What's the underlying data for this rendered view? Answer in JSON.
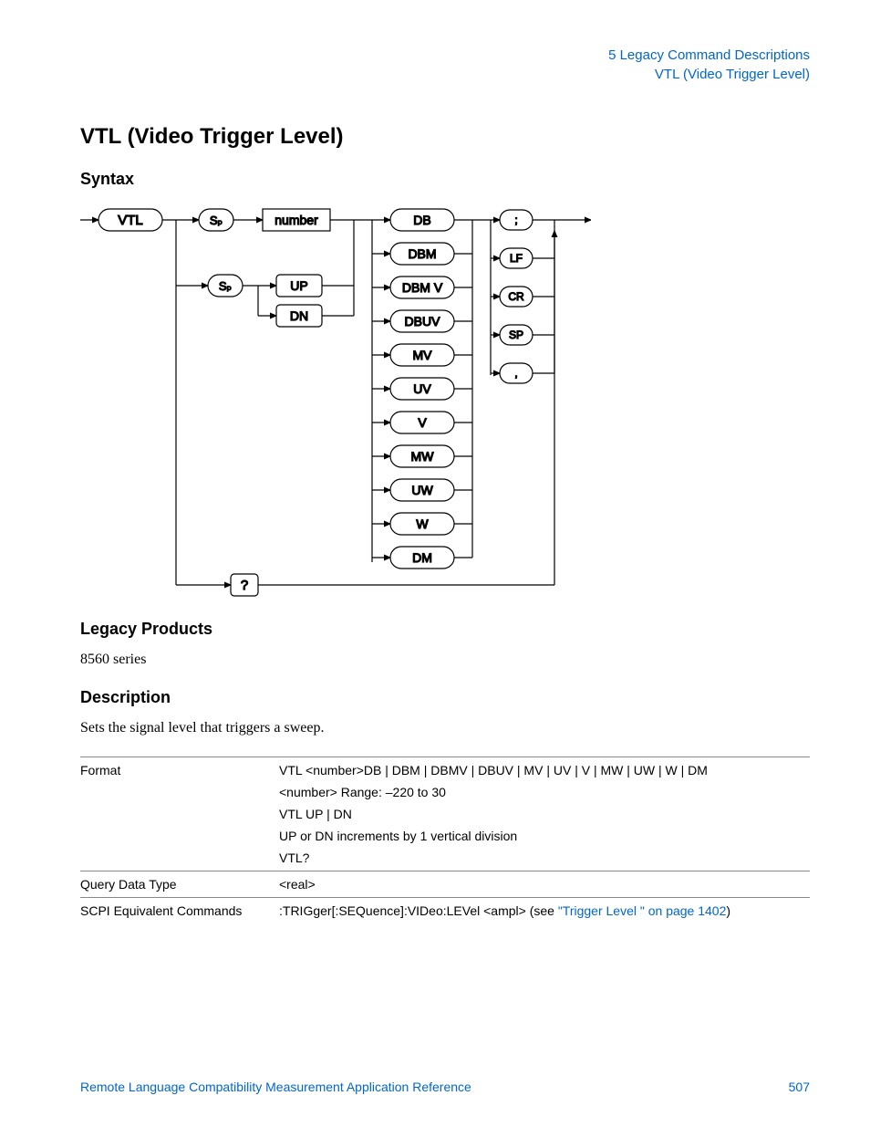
{
  "header": {
    "chapter": "5  Legacy Command Descriptions",
    "section": "VTL (Video Trigger Level)"
  },
  "title": "VTL (Video Trigger Level)",
  "syntax_heading": "Syntax",
  "diagram": {
    "start": "VTL",
    "sp1": "Sₚ",
    "number": "number",
    "sp2": "Sₚ",
    "up": "UP",
    "dn": "DN",
    "query": "?",
    "units": [
      "DB",
      "DBM",
      "DBM V",
      "DBUV",
      "MV",
      "UV",
      "V",
      "MW",
      "UW",
      "W",
      "DM"
    ],
    "terminators": [
      ";",
      "LF",
      "CR",
      "SP",
      ","
    ]
  },
  "legacy_heading": "Legacy Products",
  "legacy_text": "8560 series",
  "description_heading": "Description",
  "description_text": "Sets the signal level that triggers a sweep.",
  "table": {
    "rows": [
      {
        "label": "Format",
        "values": [
          "VTL <number>DB | DBM | DBMV | DBUV | MV | UV | V | MW | UW | W | DM",
          "<number> Range: –220 to 30",
          "VTL UP | DN",
          "UP or DN increments by 1 vertical division",
          "VTL?"
        ]
      },
      {
        "label": "Query Data Type",
        "values": [
          "<real>"
        ]
      },
      {
        "label": "SCPI Equivalent Commands",
        "scpi_prefix": ":TRIGger[:SEQuence]:VIDeo:LEVel <ampl> (see ",
        "scpi_link": "\"Trigger Level \" on page 1402",
        "scpi_suffix": ")"
      }
    ]
  },
  "footer": {
    "doc_title": "Remote Language Compatibility Measurement Application Reference",
    "page_number": "507"
  }
}
